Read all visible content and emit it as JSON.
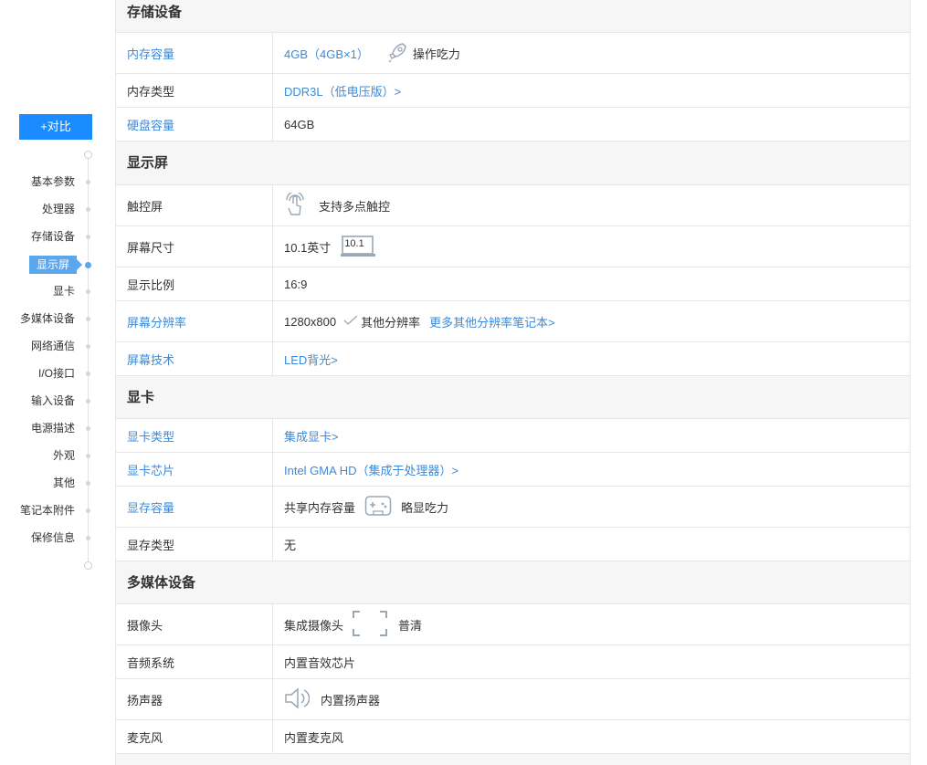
{
  "sidebar": {
    "compare_label": "+对比",
    "items": [
      {
        "label": "基本参数"
      },
      {
        "label": "处理器"
      },
      {
        "label": "存储设备"
      },
      {
        "label": "显示屏"
      },
      {
        "label": "显卡"
      },
      {
        "label": "多媒体设备"
      },
      {
        "label": "网络通信"
      },
      {
        "label": "I/O接口"
      },
      {
        "label": "输入设备"
      },
      {
        "label": "电源描述"
      },
      {
        "label": "外观"
      },
      {
        "label": "其他"
      },
      {
        "label": "笔记本附件"
      },
      {
        "label": "保修信息"
      }
    ],
    "active_index": 3
  },
  "storage": {
    "title": "存储设备",
    "rows": [
      {
        "key": "内存容量",
        "value": "4GB（4GB×1）",
        "extra": "操作吃力"
      },
      {
        "key": "内存类型",
        "value": "DDR3L（低电压版）>"
      },
      {
        "key": "硬盘容量",
        "value": "64GB"
      }
    ]
  },
  "display": {
    "title": "显示屏",
    "rows": [
      {
        "key": "触控屏",
        "value": "支持多点触控"
      },
      {
        "key": "屏幕尺寸",
        "value": "10.1英寸",
        "badge": "10.1"
      },
      {
        "key": "显示比例",
        "value": "16:9"
      },
      {
        "key": "屏幕分辨率",
        "value": "1280x800",
        "extra": "其他分辨率",
        "link": "更多其他分辨率笔记本>"
      },
      {
        "key": "屏幕技术",
        "value": "LED背光>"
      }
    ]
  },
  "gpu": {
    "title": "显卡",
    "rows": [
      {
        "key": "显卡类型",
        "value": "集成显卡>"
      },
      {
        "key": "显卡芯片",
        "value": "Intel GMA HD（集成于处理器）>"
      },
      {
        "key": "显存容量",
        "value": "共享内存容量",
        "extra": "略显吃力"
      },
      {
        "key": "显存类型",
        "value": "无"
      }
    ]
  },
  "multimedia": {
    "title": "多媒体设备",
    "rows": [
      {
        "key": "摄像头",
        "value": "集成摄像头",
        "extra": "普清"
      },
      {
        "key": "音频系统",
        "value": "内置音效芯片"
      },
      {
        "key": "扬声器",
        "value": "内置扬声器"
      },
      {
        "key": "麦克风",
        "value": "内置麦克风"
      }
    ]
  },
  "colors": {
    "accent": "#1a8cff",
    "link": "#3c8ad8",
    "nav_active": "#5aa7ee",
    "section_bg": "#f6f6f6",
    "border": "#e6e6e6"
  },
  "icons": [
    "rocket-icon",
    "touch-icon",
    "screen-size-icon",
    "check-icon",
    "gamepad-icon",
    "camera-frame-icon",
    "speaker-icon"
  ]
}
